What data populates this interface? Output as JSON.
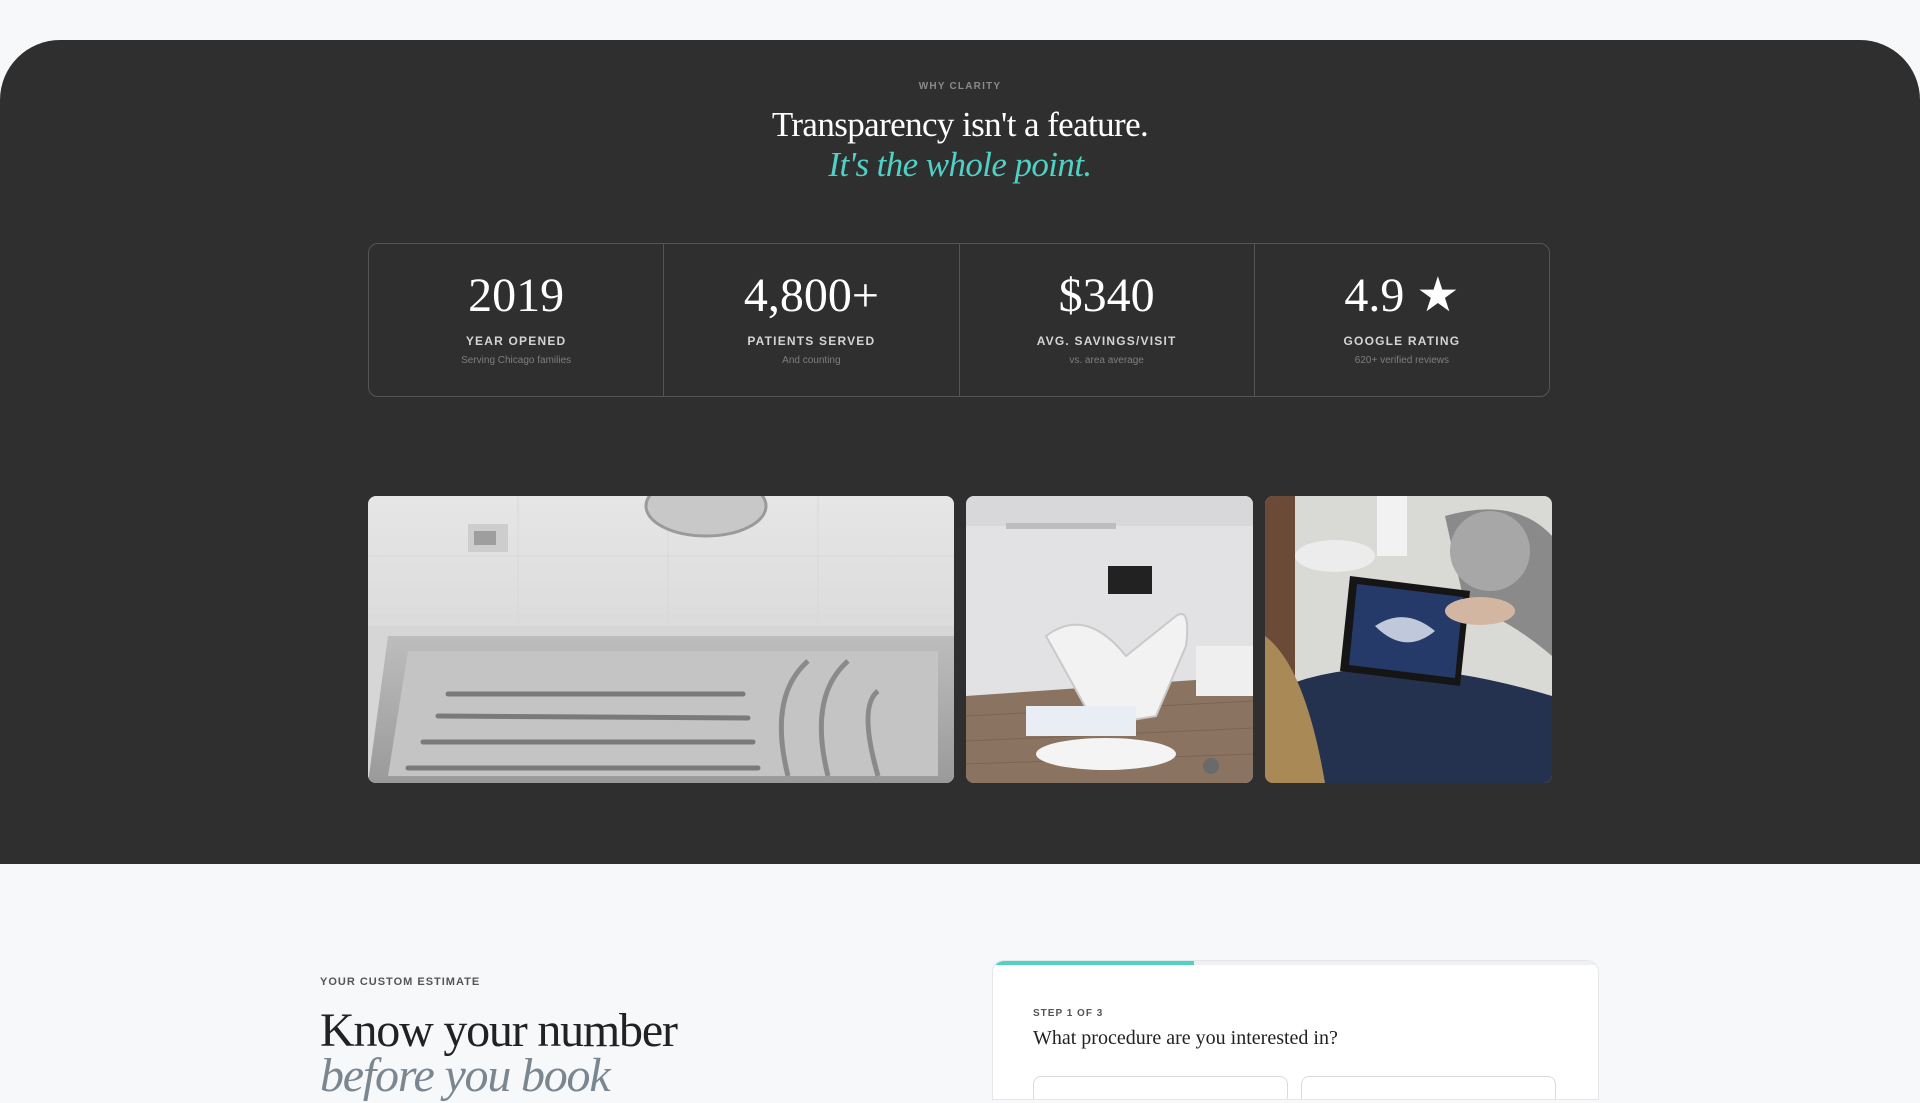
{
  "why_section": {
    "eyebrow": "WHY CLARITY",
    "headline": "Transparency isn't a feature.",
    "headline_accent": "It's the whole point.",
    "accent_color": "#4fd1c5",
    "stats": [
      {
        "value": "2019",
        "label": "YEAR OPENED",
        "sub": "Serving Chicago families"
      },
      {
        "value": "4,800+",
        "label": "PATIENTS SERVED",
        "sub": "And counting"
      },
      {
        "value": "$340",
        "label": "AVG. SAVINGS/VISIT",
        "sub": "vs. area average"
      },
      {
        "value": "4.9 ★",
        "label": "GOOGLE RATING",
        "sub": "620+ verified reviews"
      }
    ],
    "photos": [
      {
        "icon": "dental-instruments-photo"
      },
      {
        "icon": "dental-chair-photo"
      },
      {
        "icon": "tablet-xray-photo"
      }
    ]
  },
  "estimate_section": {
    "eyebrow": "YOUR CUSTOM ESTIMATE",
    "title": "Know your number",
    "title_italic": "before you book",
    "form": {
      "step_label": "STEP 1 OF 3",
      "question": "What procedure are you interested in?",
      "progress_fraction": 0.333
    }
  }
}
